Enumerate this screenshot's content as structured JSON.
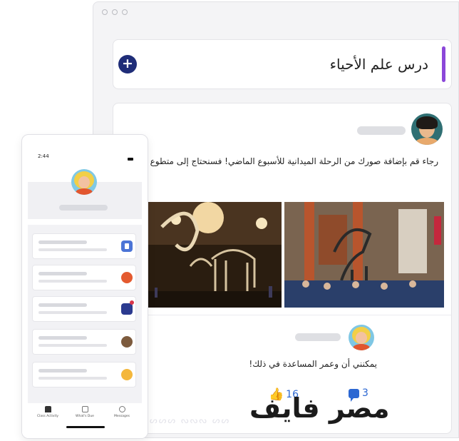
{
  "class": {
    "title": "درس علم الأحياء",
    "add_label": "+"
  },
  "post": {
    "text": "رجاء قم بإضافة صورك من الرحلة الميدانية للأسبوع الماضي! فسنحتاج إلى متطوع ليقوم بصنع",
    "reply_text": "يمكنني أن وعمر المساعدة في ذلك!",
    "likes_count": "16",
    "comments_count": "3"
  },
  "phone": {
    "time": "2:44",
    "tabs": [
      "Class Activity",
      "What's Due",
      "Messages"
    ]
  },
  "watermark": "مصر فايف",
  "decor": "ᔕᔕᔕ ᔓᔓᔓ ᔕᔕ"
}
